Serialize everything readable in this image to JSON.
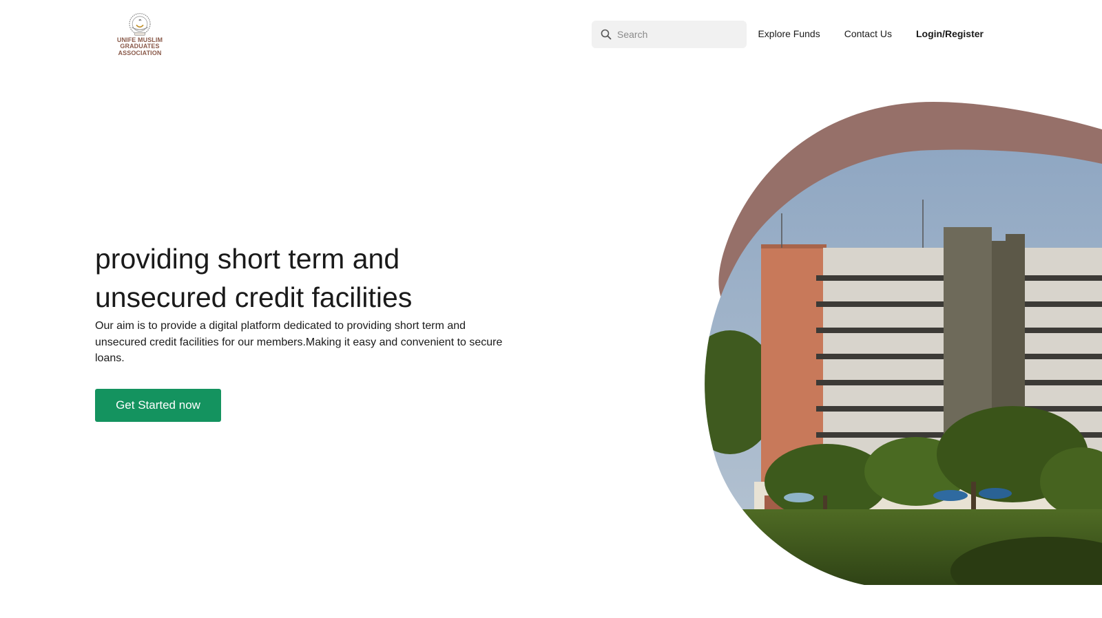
{
  "header": {
    "logo": {
      "line1": "UNIFE MUSLIM GRADUATES",
      "line2": "ASSOCIATION"
    },
    "search": {
      "placeholder": "Search",
      "icon": "search-icon"
    },
    "nav": {
      "explore": "Explore Funds",
      "contact": "Contact Us",
      "login": "Login/Register"
    }
  },
  "hero": {
    "headline_part1": "providing short ",
    "headline_highlight": "term",
    "headline_part2": " and",
    "headline_line2": "unsecured credit facilities",
    "description": "Our aim is to provide a digital platform dedicated to providing short term and unsecured credit facilities for our members.Making it easy and convenient to secure loans.",
    "cta_label": "Get Started now"
  },
  "colors": {
    "accent_green": "#14935f",
    "highlight_mint": "#a8e2cf",
    "blob_mauve": "#967069",
    "logo_brown": "#8a5a4a"
  }
}
